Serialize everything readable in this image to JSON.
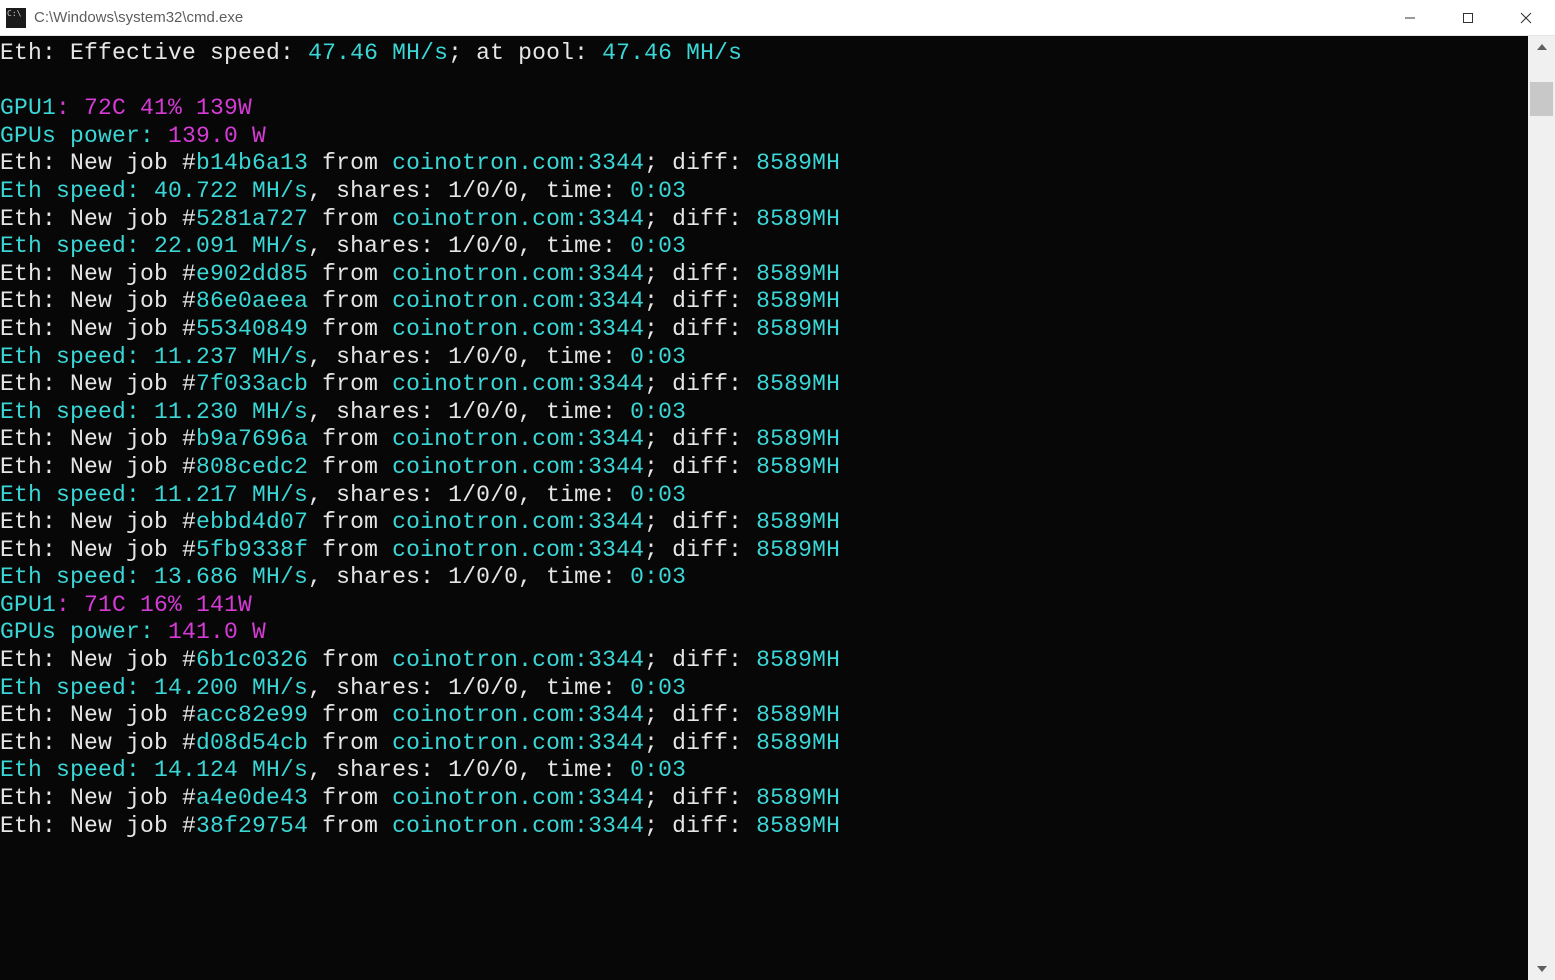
{
  "window": {
    "title": "C:\\Windows\\system32\\cmd.exe"
  },
  "console": {
    "lines": [
      {
        "segments": [
          {
            "cls": "c-white",
            "text": "Eth: Effective speed: "
          },
          {
            "cls": "c-cyan",
            "text": "47.46 MH/s"
          },
          {
            "cls": "c-white",
            "text": "; at pool: "
          },
          {
            "cls": "c-cyan",
            "text": "47.46 MH/s"
          }
        ]
      },
      {
        "segments": [
          {
            "cls": "c-white",
            "text": " "
          }
        ]
      },
      {
        "segments": [
          {
            "cls": "c-cyan",
            "text": "GPU1"
          },
          {
            "cls": "c-mag",
            "text": ": 72C 41% 139W"
          }
        ]
      },
      {
        "segments": [
          {
            "cls": "c-cyan",
            "text": "GPUs power: "
          },
          {
            "cls": "c-mag",
            "text": "139.0 W"
          }
        ]
      },
      {
        "segments": [
          {
            "cls": "c-white",
            "text": "Eth: New job #"
          },
          {
            "cls": "c-cyan",
            "text": "b14b6a13"
          },
          {
            "cls": "c-white",
            "text": " from "
          },
          {
            "cls": "c-cyan",
            "text": "coinotron.com:3344"
          },
          {
            "cls": "c-white",
            "text": "; diff: "
          },
          {
            "cls": "c-cyan",
            "text": "8589MH"
          }
        ]
      },
      {
        "segments": [
          {
            "cls": "c-cyan",
            "text": "Eth speed: 40.722 MH/s"
          },
          {
            "cls": "c-white",
            "text": ", shares: 1/0/0, time: "
          },
          {
            "cls": "c-cyan",
            "text": "0:03"
          }
        ]
      },
      {
        "segments": [
          {
            "cls": "c-white",
            "text": "Eth: New job #"
          },
          {
            "cls": "c-cyan",
            "text": "5281a727"
          },
          {
            "cls": "c-white",
            "text": " from "
          },
          {
            "cls": "c-cyan",
            "text": "coinotron.com:3344"
          },
          {
            "cls": "c-white",
            "text": "; diff: "
          },
          {
            "cls": "c-cyan",
            "text": "8589MH"
          }
        ]
      },
      {
        "segments": [
          {
            "cls": "c-cyan",
            "text": "Eth speed: 22.091 MH/s"
          },
          {
            "cls": "c-white",
            "text": ", shares: 1/0/0, time: "
          },
          {
            "cls": "c-cyan",
            "text": "0:03"
          }
        ]
      },
      {
        "segments": [
          {
            "cls": "c-white",
            "text": "Eth: New job #"
          },
          {
            "cls": "c-cyan",
            "text": "e902dd85"
          },
          {
            "cls": "c-white",
            "text": " from "
          },
          {
            "cls": "c-cyan",
            "text": "coinotron.com:3344"
          },
          {
            "cls": "c-white",
            "text": "; diff: "
          },
          {
            "cls": "c-cyan",
            "text": "8589MH"
          }
        ]
      },
      {
        "segments": [
          {
            "cls": "c-white",
            "text": "Eth: New job #"
          },
          {
            "cls": "c-cyan",
            "text": "86e0aeea"
          },
          {
            "cls": "c-white",
            "text": " from "
          },
          {
            "cls": "c-cyan",
            "text": "coinotron.com:3344"
          },
          {
            "cls": "c-white",
            "text": "; diff: "
          },
          {
            "cls": "c-cyan",
            "text": "8589MH"
          }
        ]
      },
      {
        "segments": [
          {
            "cls": "c-white",
            "text": "Eth: New job #"
          },
          {
            "cls": "c-cyan",
            "text": "55340849"
          },
          {
            "cls": "c-white",
            "text": " from "
          },
          {
            "cls": "c-cyan",
            "text": "coinotron.com:3344"
          },
          {
            "cls": "c-white",
            "text": "; diff: "
          },
          {
            "cls": "c-cyan",
            "text": "8589MH"
          }
        ]
      },
      {
        "segments": [
          {
            "cls": "c-cyan",
            "text": "Eth speed: 11.237 MH/s"
          },
          {
            "cls": "c-white",
            "text": ", shares: 1/0/0, time: "
          },
          {
            "cls": "c-cyan",
            "text": "0:03"
          }
        ]
      },
      {
        "segments": [
          {
            "cls": "c-white",
            "text": "Eth: New job #"
          },
          {
            "cls": "c-cyan",
            "text": "7f033acb"
          },
          {
            "cls": "c-white",
            "text": " from "
          },
          {
            "cls": "c-cyan",
            "text": "coinotron.com:3344"
          },
          {
            "cls": "c-white",
            "text": "; diff: "
          },
          {
            "cls": "c-cyan",
            "text": "8589MH"
          }
        ]
      },
      {
        "segments": [
          {
            "cls": "c-cyan",
            "text": "Eth speed: 11.230 MH/s"
          },
          {
            "cls": "c-white",
            "text": ", shares: 1/0/0, time: "
          },
          {
            "cls": "c-cyan",
            "text": "0:03"
          }
        ]
      },
      {
        "segments": [
          {
            "cls": "c-white",
            "text": "Eth: New job #"
          },
          {
            "cls": "c-cyan",
            "text": "b9a7696a"
          },
          {
            "cls": "c-white",
            "text": " from "
          },
          {
            "cls": "c-cyan",
            "text": "coinotron.com:3344"
          },
          {
            "cls": "c-white",
            "text": "; diff: "
          },
          {
            "cls": "c-cyan",
            "text": "8589MH"
          }
        ]
      },
      {
        "segments": [
          {
            "cls": "c-white",
            "text": "Eth: New job #"
          },
          {
            "cls": "c-cyan",
            "text": "808cedc2"
          },
          {
            "cls": "c-white",
            "text": " from "
          },
          {
            "cls": "c-cyan",
            "text": "coinotron.com:3344"
          },
          {
            "cls": "c-white",
            "text": "; diff: "
          },
          {
            "cls": "c-cyan",
            "text": "8589MH"
          }
        ]
      },
      {
        "segments": [
          {
            "cls": "c-cyan",
            "text": "Eth speed: 11.217 MH/s"
          },
          {
            "cls": "c-white",
            "text": ", shares: 1/0/0, time: "
          },
          {
            "cls": "c-cyan",
            "text": "0:03"
          }
        ]
      },
      {
        "segments": [
          {
            "cls": "c-white",
            "text": "Eth: New job #"
          },
          {
            "cls": "c-cyan",
            "text": "ebbd4d07"
          },
          {
            "cls": "c-white",
            "text": " from "
          },
          {
            "cls": "c-cyan",
            "text": "coinotron.com:3344"
          },
          {
            "cls": "c-white",
            "text": "; diff: "
          },
          {
            "cls": "c-cyan",
            "text": "8589MH"
          }
        ]
      },
      {
        "segments": [
          {
            "cls": "c-white",
            "text": "Eth: New job #"
          },
          {
            "cls": "c-cyan",
            "text": "5fb9338f"
          },
          {
            "cls": "c-white",
            "text": " from "
          },
          {
            "cls": "c-cyan",
            "text": "coinotron.com:3344"
          },
          {
            "cls": "c-white",
            "text": "; diff: "
          },
          {
            "cls": "c-cyan",
            "text": "8589MH"
          }
        ]
      },
      {
        "segments": [
          {
            "cls": "c-cyan",
            "text": "Eth speed: 13.686 MH/s"
          },
          {
            "cls": "c-white",
            "text": ", shares: 1/0/0, time: "
          },
          {
            "cls": "c-cyan",
            "text": "0:03"
          }
        ]
      },
      {
        "segments": [
          {
            "cls": "c-cyan",
            "text": "GPU1"
          },
          {
            "cls": "c-mag",
            "text": ": 71C 16% 141W"
          }
        ]
      },
      {
        "segments": [
          {
            "cls": "c-cyan",
            "text": "GPUs power: "
          },
          {
            "cls": "c-mag",
            "text": "141.0 W"
          }
        ]
      },
      {
        "segments": [
          {
            "cls": "c-white",
            "text": "Eth: New job #"
          },
          {
            "cls": "c-cyan",
            "text": "6b1c0326"
          },
          {
            "cls": "c-white",
            "text": " from "
          },
          {
            "cls": "c-cyan",
            "text": "coinotron.com:3344"
          },
          {
            "cls": "c-white",
            "text": "; diff: "
          },
          {
            "cls": "c-cyan",
            "text": "8589MH"
          }
        ]
      },
      {
        "segments": [
          {
            "cls": "c-cyan",
            "text": "Eth speed: 14.200 MH/s"
          },
          {
            "cls": "c-white",
            "text": ", shares: 1/0/0, time: "
          },
          {
            "cls": "c-cyan",
            "text": "0:03"
          }
        ]
      },
      {
        "segments": [
          {
            "cls": "c-white",
            "text": "Eth: New job #"
          },
          {
            "cls": "c-cyan",
            "text": "acc82e99"
          },
          {
            "cls": "c-white",
            "text": " from "
          },
          {
            "cls": "c-cyan",
            "text": "coinotron.com:3344"
          },
          {
            "cls": "c-white",
            "text": "; diff: "
          },
          {
            "cls": "c-cyan",
            "text": "8589MH"
          }
        ]
      },
      {
        "segments": [
          {
            "cls": "c-white",
            "text": "Eth: New job #"
          },
          {
            "cls": "c-cyan",
            "text": "d08d54cb"
          },
          {
            "cls": "c-white",
            "text": " from "
          },
          {
            "cls": "c-cyan",
            "text": "coinotron.com:3344"
          },
          {
            "cls": "c-white",
            "text": "; diff: "
          },
          {
            "cls": "c-cyan",
            "text": "8589MH"
          }
        ]
      },
      {
        "segments": [
          {
            "cls": "c-cyan",
            "text": "Eth speed: 14.124 MH/s"
          },
          {
            "cls": "c-white",
            "text": ", shares: 1/0/0, time: "
          },
          {
            "cls": "c-cyan",
            "text": "0:03"
          }
        ]
      },
      {
        "segments": [
          {
            "cls": "c-white",
            "text": "Eth: New job #"
          },
          {
            "cls": "c-cyan",
            "text": "a4e0de43"
          },
          {
            "cls": "c-white",
            "text": " from "
          },
          {
            "cls": "c-cyan",
            "text": "coinotron.com:3344"
          },
          {
            "cls": "c-white",
            "text": "; diff: "
          },
          {
            "cls": "c-cyan",
            "text": "8589MH"
          }
        ]
      },
      {
        "segments": [
          {
            "cls": "c-white",
            "text": "Eth: New job #"
          },
          {
            "cls": "c-cyan",
            "text": "38f29754"
          },
          {
            "cls": "c-white",
            "text": " from "
          },
          {
            "cls": "c-cyan",
            "text": "coinotron.com:3344"
          },
          {
            "cls": "c-white",
            "text": "; diff: "
          },
          {
            "cls": "c-cyan",
            "text": "8589MH"
          }
        ]
      }
    ]
  }
}
